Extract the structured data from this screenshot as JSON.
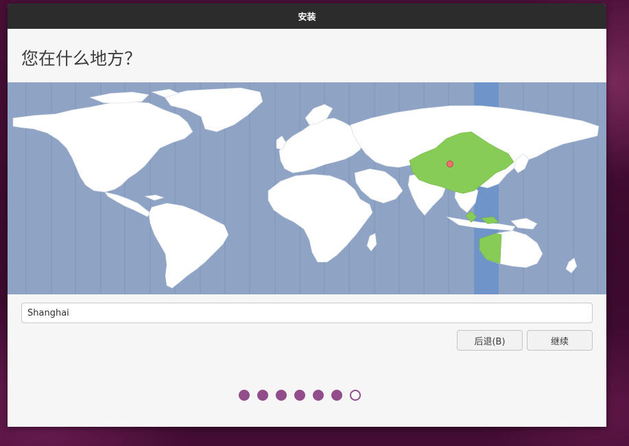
{
  "window": {
    "title": "安装"
  },
  "page": {
    "heading": "您在什么地方？"
  },
  "location": {
    "value": "Shanghai"
  },
  "buttons": {
    "back": "后退(B)",
    "continue": "继续"
  },
  "progress": {
    "total_steps": 7,
    "completed_steps": 6,
    "current_step": 7
  },
  "colors": {
    "ocean": "#8fa4c5",
    "land": "#ffffff",
    "selected_region": "#87cc56",
    "timezone_band": "#6f94c9",
    "step_dot": "#924d8b",
    "titlebar": "#2c2c2c"
  }
}
